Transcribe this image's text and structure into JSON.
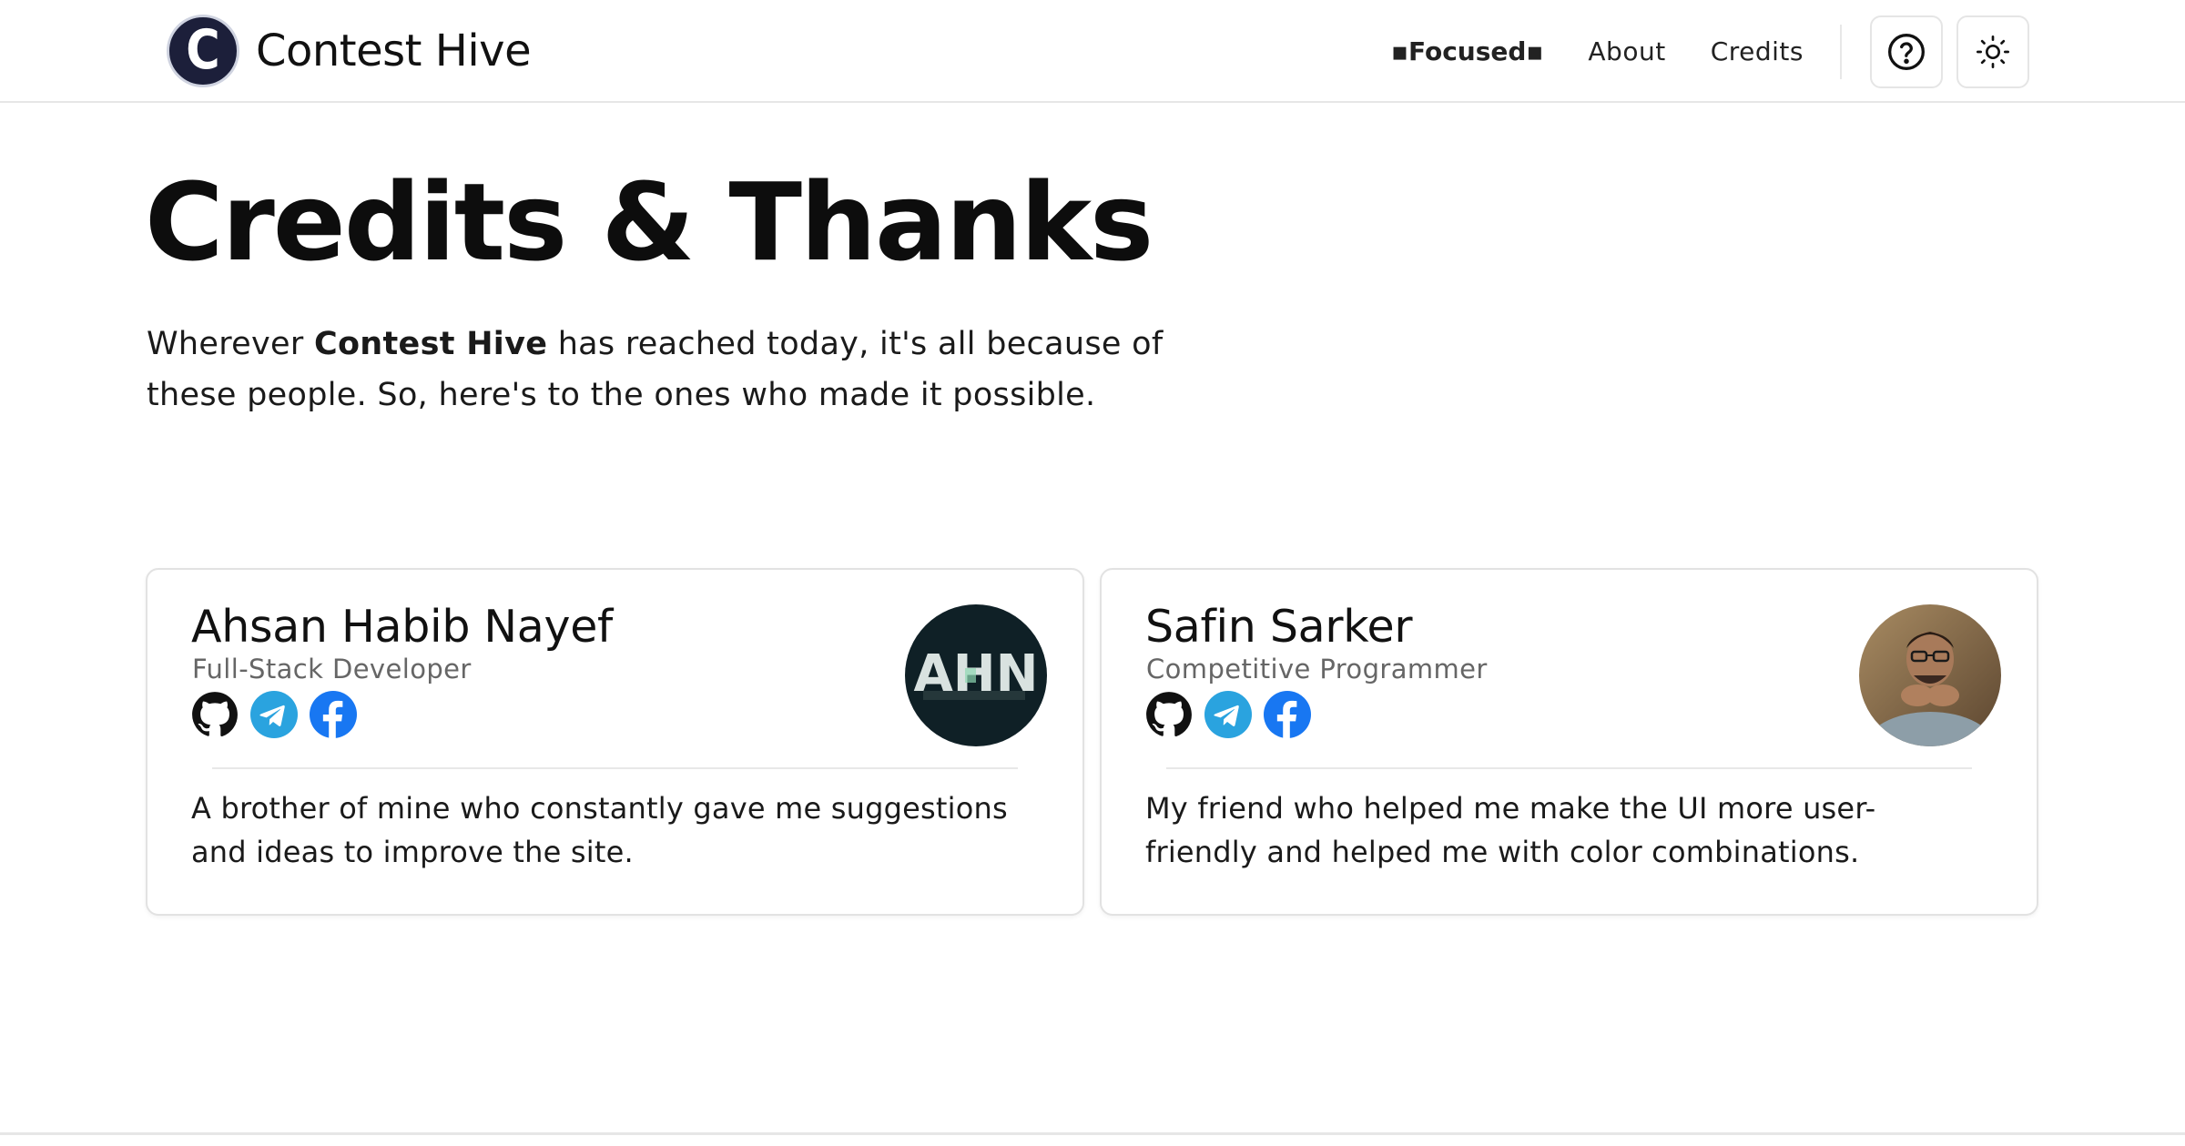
{
  "header": {
    "logo_letter": "C",
    "brand_name": "Contest Hive",
    "nav": {
      "focused": "▪Focused▪",
      "about": "About",
      "credits": "Credits"
    },
    "help_icon": "question-circle-icon",
    "theme_icon": "sun-icon"
  },
  "hero": {
    "title": "Credits & Thanks",
    "text_before": "Wherever ",
    "text_bold": "Contest Hive",
    "text_after": " has reached today, it's all because of these people. So, here's to the ones who made it possible."
  },
  "cards": [
    {
      "name": "Ahsan Habib Nayef",
      "role": "Full-Stack Developer",
      "avatar_text": "AHN",
      "socials": [
        "github-icon",
        "telegram-icon",
        "facebook-icon"
      ],
      "description": "A brother of mine who constantly gave me suggestions and ideas to improve the site."
    },
    {
      "name": "Safin Sarker",
      "role": "Competitive Programmer",
      "socials": [
        "github-icon",
        "telegram-icon",
        "facebook-icon"
      ],
      "description": "My friend who helped me make the UI more user-friendly and helped me with color combinations."
    }
  ],
  "colors": {
    "logo_bg": "#1c1f3a",
    "telegram": "#2aa3df",
    "facebook": "#1877f2",
    "github": "#111111",
    "muted_text": "#666666",
    "border": "#e2e2e2"
  }
}
